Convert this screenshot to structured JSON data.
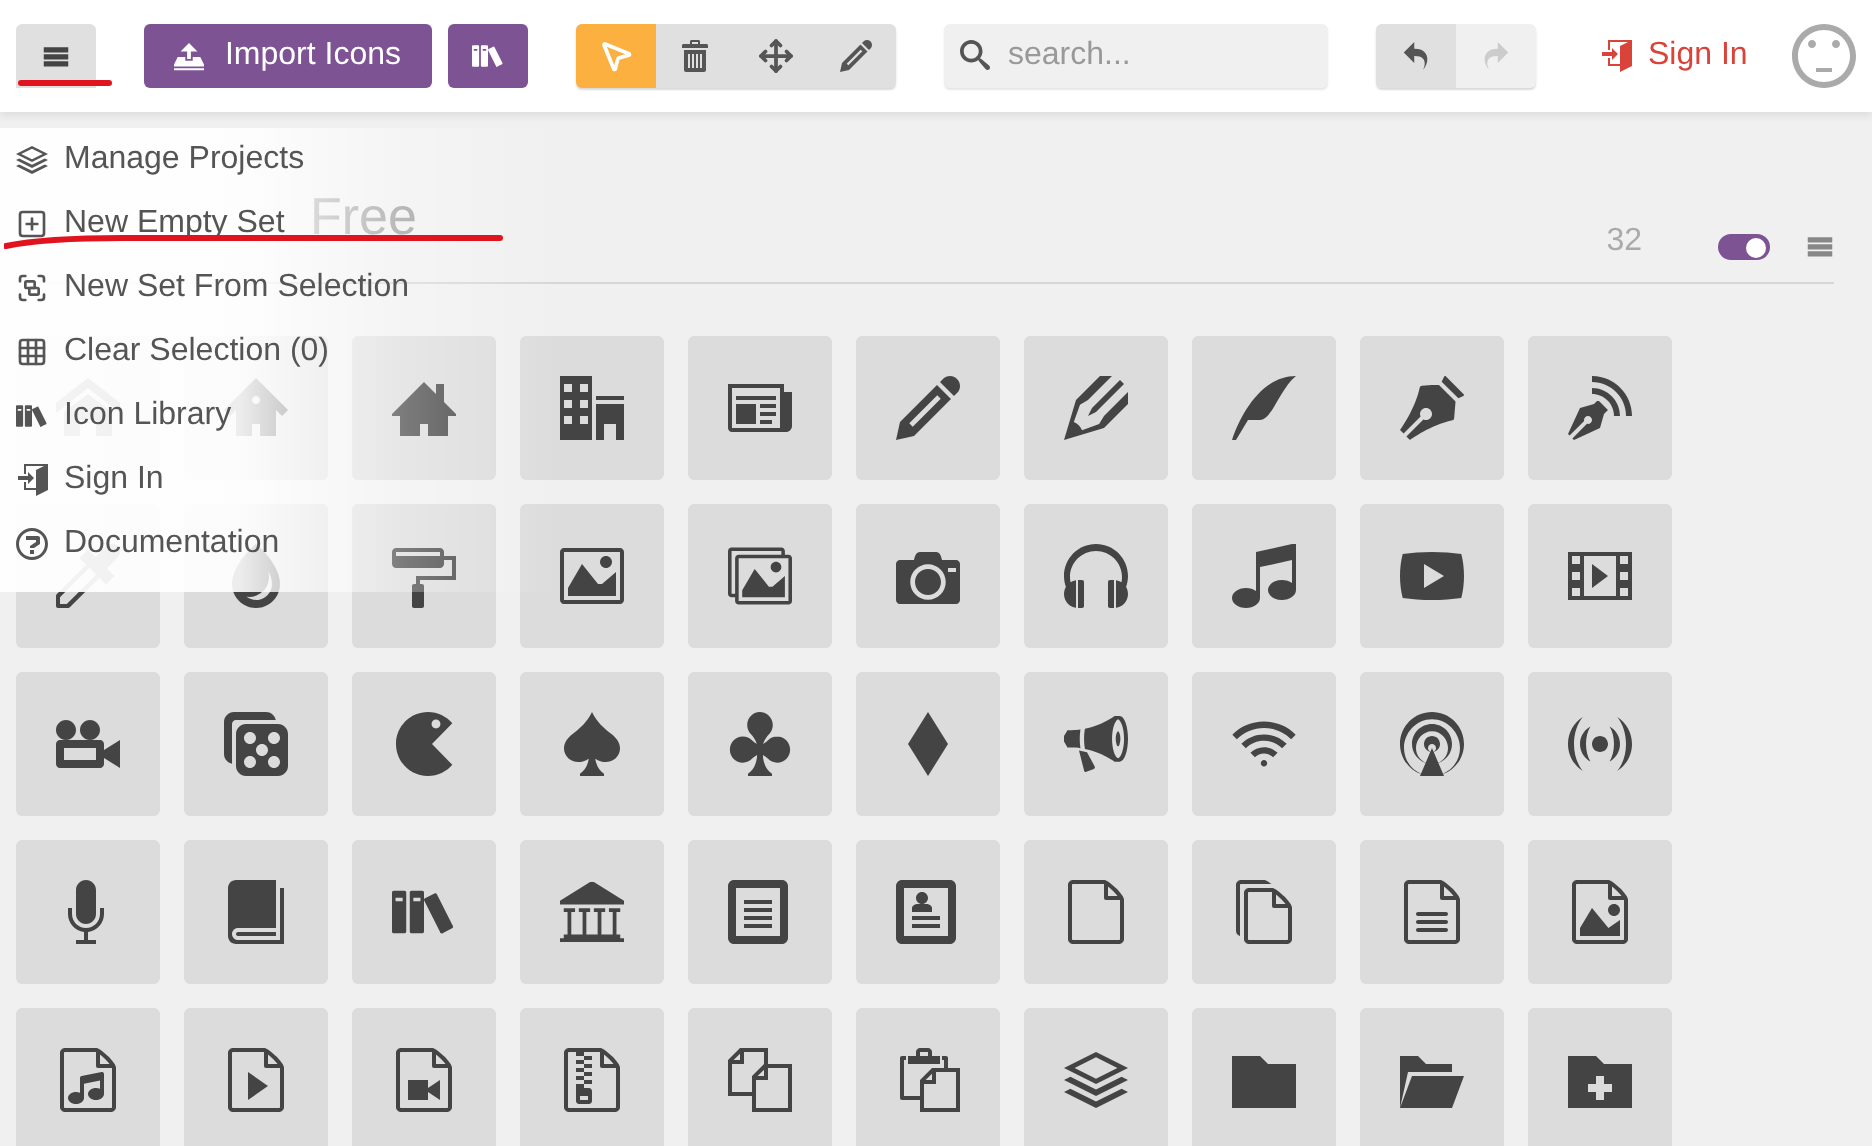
{
  "toolbar": {
    "import_button": {
      "label": "Import Icons"
    },
    "tools": [
      {
        "kind": "select",
        "selected": true
      },
      {
        "kind": "delete",
        "selected": false
      },
      {
        "kind": "move",
        "selected": false
      },
      {
        "kind": "edit",
        "selected": false
      }
    ],
    "search": {
      "placeholder": "search..."
    },
    "history": [
      {
        "kind": "undo",
        "disabled": false
      },
      {
        "kind": "redo",
        "disabled": true
      }
    ],
    "sign_in": {
      "label": "Sign In"
    }
  },
  "menu": {
    "items": [
      {
        "kind": "projects",
        "label": "Manage Projects"
      },
      {
        "kind": "new",
        "label": "New Empty Set"
      },
      {
        "kind": "from-selection",
        "label": "New Set From Selection"
      },
      {
        "kind": "clear",
        "label": "Clear Selection (0)"
      },
      {
        "kind": "library",
        "label": "Icon Library"
      },
      {
        "kind": "signin",
        "label": "Sign In"
      },
      {
        "kind": "docs",
        "label": "Documentation"
      }
    ]
  },
  "set_header": {
    "title": "Free",
    "count": "32",
    "toggle_on": true
  }
}
